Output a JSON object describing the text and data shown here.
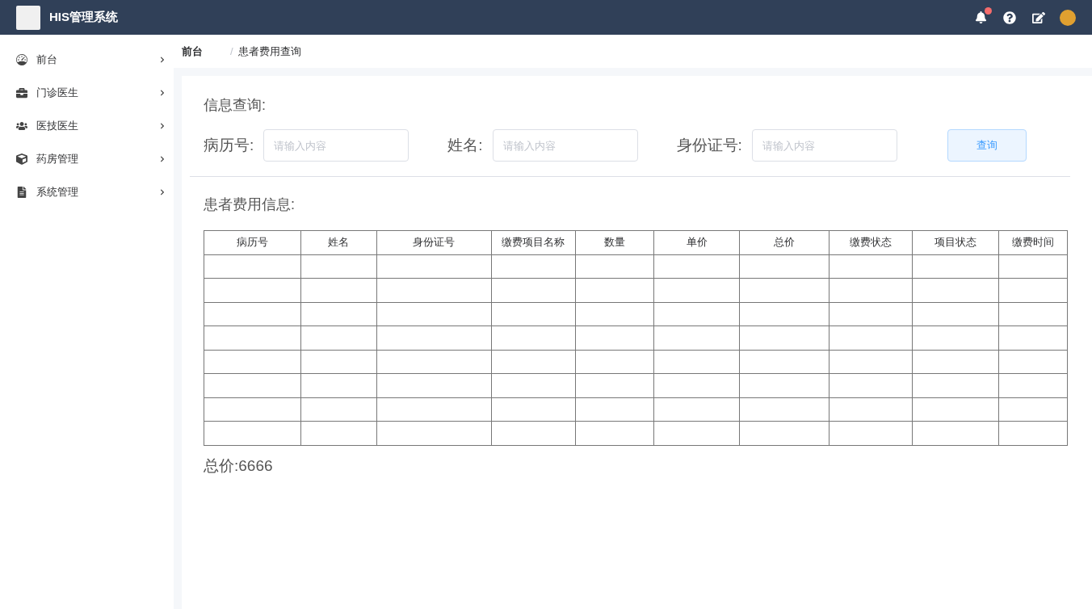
{
  "header": {
    "title": "HIS管理系统",
    "notification": {
      "unread": true
    }
  },
  "sidebar": {
    "items": [
      {
        "label": "前台"
      },
      {
        "label": "门诊医生"
      },
      {
        "label": "医技医生"
      },
      {
        "label": "药房管理"
      },
      {
        "label": "系统管理"
      }
    ]
  },
  "breadcrumb": {
    "separator": "/",
    "items": [
      "前台",
      "患者费用查询"
    ]
  },
  "query": {
    "title": "信息查询:",
    "fields": [
      {
        "label": "病历号:",
        "placeholder": "请输入内容"
      },
      {
        "label": "姓名:",
        "placeholder": "请输入内容"
      },
      {
        "label": "身份证号:",
        "placeholder": "请输入内容"
      }
    ],
    "button": "查询"
  },
  "table": {
    "title": "患者费用信息:",
    "columns": [
      "病历号",
      "姓名",
      "身份证号",
      "缴费项目名称",
      "数量",
      "单价",
      "总价",
      "缴费状态",
      "项目状态",
      "缴费时间"
    ]
  },
  "total": "总价:6666"
}
